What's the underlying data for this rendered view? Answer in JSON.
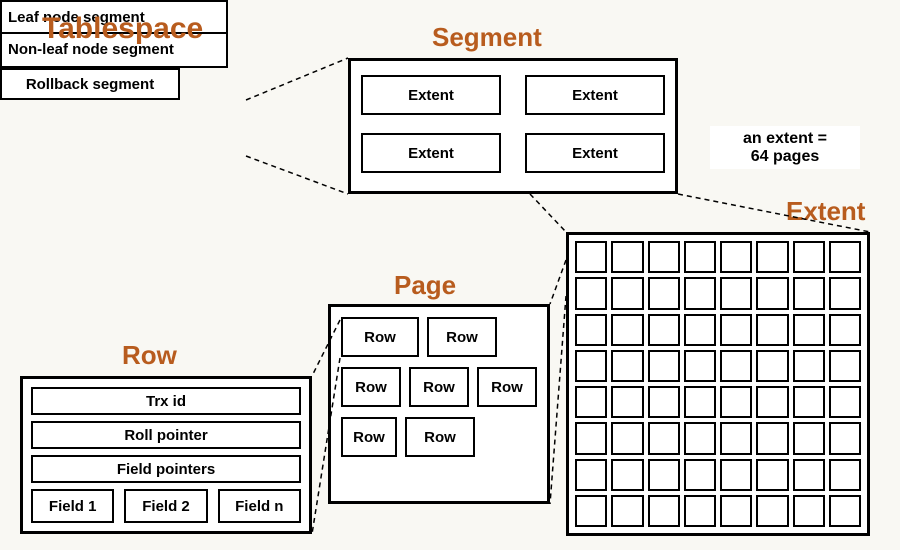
{
  "titles": {
    "tablespace": "Tablespace",
    "segment": "Segment",
    "page": "Page",
    "extent": "Extent",
    "row": "Row"
  },
  "tablespace": {
    "segments": [
      "Leaf node segment",
      "Non-leaf node segment"
    ],
    "rollback": "Rollback segment"
  },
  "segment": {
    "extents": [
      "Extent",
      "Extent",
      "Extent",
      "Extent"
    ]
  },
  "extent": {
    "note_line1": "an extent =",
    "note_line2": "64 pages",
    "grid_cols": 8,
    "grid_rows": 8,
    "page_count": 64
  },
  "page": {
    "rows": [
      "Row",
      "Row",
      "Row",
      "Row",
      "Row",
      "Row",
      "Row"
    ]
  },
  "row": {
    "parts": [
      "Trx id",
      "Roll pointer",
      "Field pointers"
    ],
    "fields": [
      "Field 1",
      "Field 2",
      "Field n"
    ]
  },
  "colors": {
    "accent": "#b85c1e",
    "bg": "#f9f8f3"
  }
}
